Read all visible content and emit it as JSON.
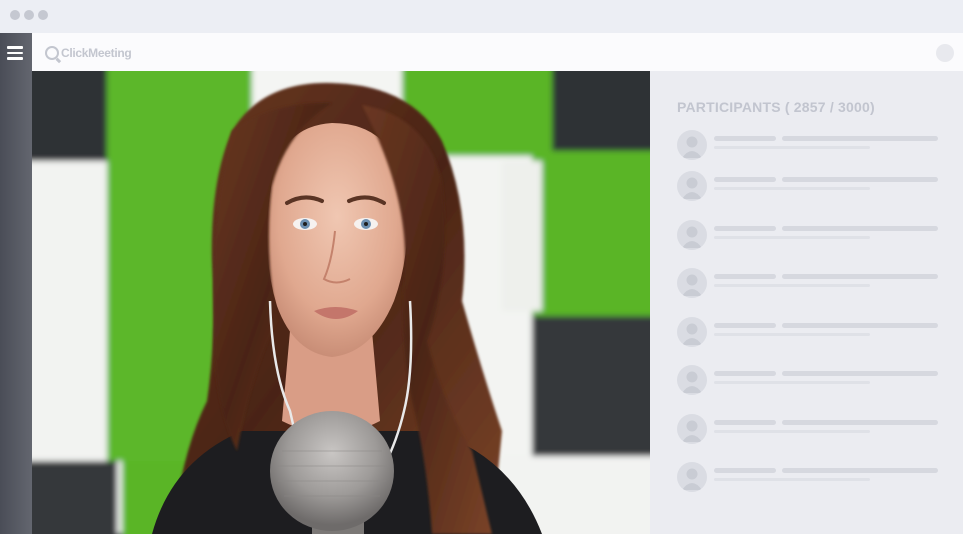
{
  "window": {
    "controls": [
      "close",
      "minimize",
      "maximize"
    ]
  },
  "sidebar": {
    "menu_icon": "hamburger-menu-icon"
  },
  "appbar": {
    "logo_text": "ClickMeeting",
    "avatar_icon": "user-avatar-icon"
  },
  "video": {
    "description_icon": "webcam-video-feed"
  },
  "participants": {
    "title": "PARTICIPANTS ( 2857 / 3000)",
    "count": 2857,
    "max": 3000,
    "rows": [
      {
        "avatar": "user-avatar-icon"
      },
      {
        "avatar": "user-avatar-icon"
      },
      {
        "avatar": "user-avatar-icon"
      },
      {
        "avatar": "user-avatar-icon"
      },
      {
        "avatar": "user-avatar-icon"
      },
      {
        "avatar": "user-avatar-icon"
      },
      {
        "avatar": "user-avatar-icon"
      },
      {
        "avatar": "user-avatar-icon"
      }
    ]
  },
  "colors": {
    "accent_green": "#5bb827",
    "panel_bg": "#ebecf1",
    "sidebar_bg": "#4a4d57"
  }
}
